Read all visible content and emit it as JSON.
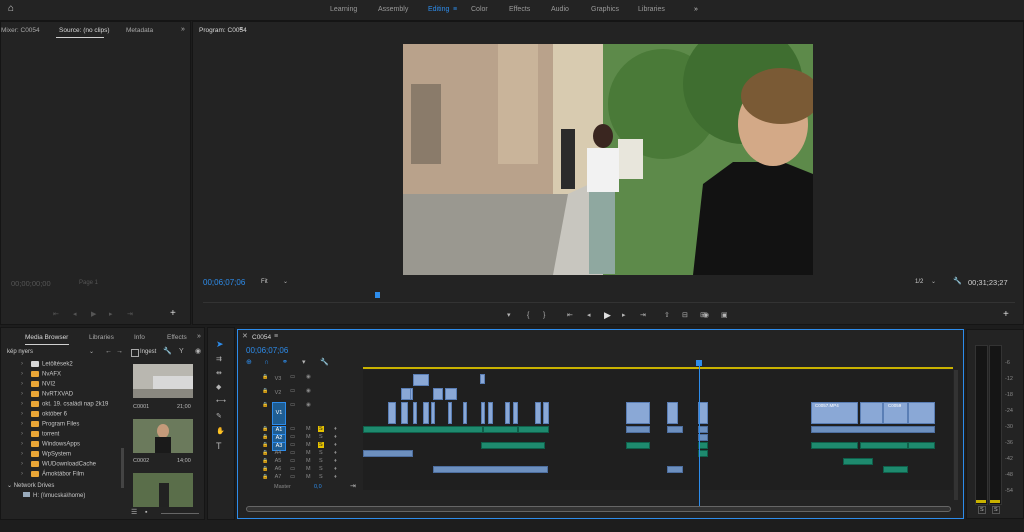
{
  "workspaces": [
    "Learning",
    "Assembly",
    "Editing",
    "Color",
    "Effects",
    "Audio",
    "Graphics",
    "Libraries"
  ],
  "active_workspace": "Editing",
  "source_panel": {
    "tabs": [
      "Mixer: C0054",
      "Source: (no clips)",
      "Metadata"
    ],
    "timecode": "00;00;00;00",
    "page_label": "Page 1"
  },
  "program_panel": {
    "title": "Program: C0054",
    "timecode": "00;06;07;06",
    "fit": "Fit",
    "resolution": "1/2",
    "duration": "00;31;23;27",
    "playhead_fraction": 0.214
  },
  "media_browser": {
    "tabs": [
      "Media Browser",
      "Libraries",
      "Info",
      "Effects"
    ],
    "dropdown": "kép nyers",
    "ingest_label": "Ingest",
    "folders": [
      "Letöltések2",
      "NvAFX",
      "NVI2",
      "NvRTXVAD",
      "okt. 19. családi nap 2k19",
      "október 6",
      "Program Files",
      "torrent",
      "WindowsApps",
      "WpSystem",
      "WUDownloadCache",
      "Ámoktábor Film"
    ],
    "network_label": "Network Drives",
    "network_drive": "H: (\\\\mucska\\home)",
    "thumbs": [
      {
        "name": "C0001",
        "duration": "21;00"
      },
      {
        "name": "C0002",
        "duration": "14;00"
      }
    ]
  },
  "timeline": {
    "tab": "C0054",
    "timecode": "00;06;07;06",
    "video_tracks": [
      "V3",
      "V2",
      "V1"
    ],
    "audio_tracks": [
      "A1",
      "A2",
      "A3",
      "A4",
      "A5",
      "A6",
      "A7"
    ],
    "master_label": "Master",
    "master_value": "0,0",
    "clip_labels": [
      "C0057.MP4",
      "C0059"
    ],
    "playhead_fraction": 0.57
  },
  "meter": {
    "scale": [
      "-6",
      "-12",
      "-18",
      "-24",
      "-30",
      "-36",
      "-42",
      "-48",
      "-54"
    ],
    "solo": "S"
  },
  "colors": {
    "accent": "#2d8ceb",
    "video_clip": "#8aa8d6",
    "audio_clip": "#1e8a6e",
    "folder": "#e8a536"
  }
}
